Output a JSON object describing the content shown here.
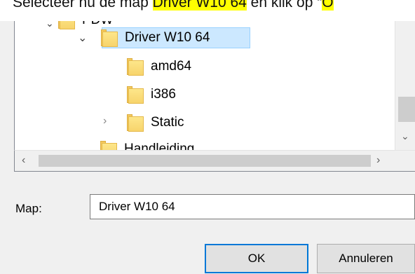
{
  "doc": {
    "prefix": "Selecteer nu de map ",
    "highlight1": "Driver W10 64",
    "middle": " en klik op “",
    "highlight2": "O"
  },
  "tree": {
    "items": [
      {
        "label": "PDW"
      },
      {
        "label": "Driver W10 64",
        "selected": true
      },
      {
        "label": "amd64"
      },
      {
        "label": "i386"
      },
      {
        "label": "Static"
      },
      {
        "label": "Handleiding"
      }
    ]
  },
  "map": {
    "label": "Map:",
    "value": "Driver W10 64"
  },
  "buttons": {
    "ok": "OK",
    "cancel": "Annuleren"
  },
  "icons": [
    "chevron-down-icon",
    "chevron-right-icon",
    "folder-icon",
    "scroll-left-icon",
    "scroll-right-icon",
    "scroll-down-icon"
  ],
  "colors": {
    "highlight": "#ffff00",
    "selection": "#cce8ff",
    "accent": "#0078d7"
  }
}
